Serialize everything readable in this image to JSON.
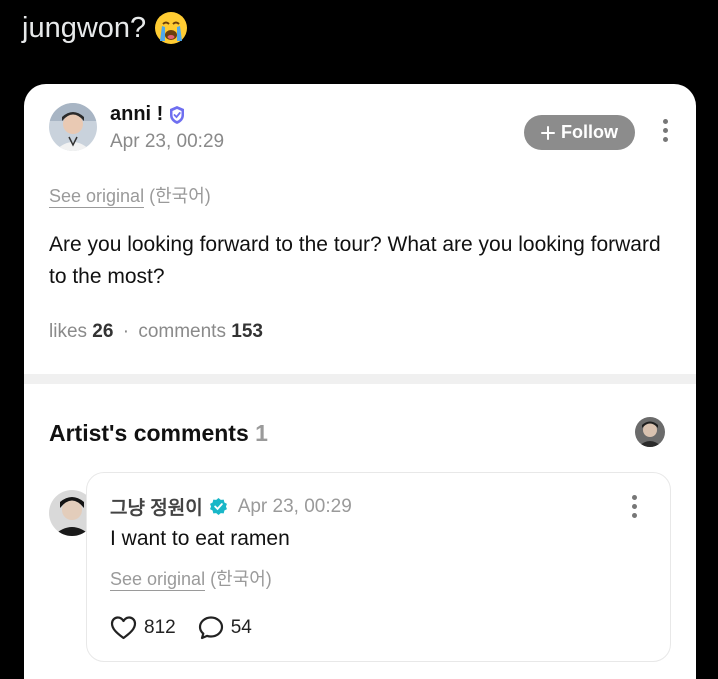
{
  "tweet": {
    "text": "jungwon?",
    "emoji": "loudly-crying-face-emoji"
  },
  "post": {
    "author": "anni !",
    "verified_badge": "shield-check-icon",
    "timestamp": "Apr 23, 00:29",
    "follow_label": "Follow",
    "see_original_link": "See original",
    "see_original_lang": "(한국어)",
    "body": "Are you looking forward to the tour? What are you looking forward to the most?",
    "likes_label": "likes",
    "likes_count": "26",
    "separator": "·",
    "comments_label": "comments",
    "comments_count": "153"
  },
  "artist_comments": {
    "title": "Artist's comments",
    "count": "1",
    "comment": {
      "author": "그냥 정원이",
      "timestamp": "Apr 23, 00:29",
      "text": "I want to eat ramen",
      "see_original_link": "See original",
      "see_original_lang": "(한국어)",
      "likes": "812",
      "replies": "54"
    }
  },
  "colors": {
    "background": "#000000",
    "card": "#ffffff",
    "follow_button": "#8c8c8c",
    "muted_text": "#8a8a8a",
    "verified_teal": "#19b7c8",
    "badge_purple": "#6f6ff0"
  }
}
